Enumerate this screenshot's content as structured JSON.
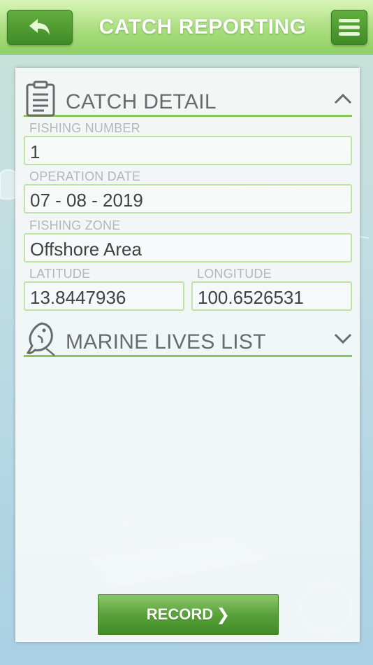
{
  "header": {
    "title": "CATCH REPORTING",
    "back_icon": "back-arrow-icon",
    "menu_icon": "hamburger-menu-icon"
  },
  "catch_detail": {
    "title": "CATCH DETAIL",
    "icon": "clipboard-icon",
    "expanded": true,
    "fishing_number": {
      "label": "FISHING NUMBER",
      "value": "1"
    },
    "operation_date": {
      "label": "OPERATION DATE",
      "value": "07 - 08 - 2019"
    },
    "fishing_zone": {
      "label": "FISHING ZONE",
      "value": "Offshore Area"
    },
    "latitude": {
      "label": "LATITUDE",
      "value": "13.8447936"
    },
    "longitude": {
      "label": "LONGITUDE",
      "value": "100.6526531"
    }
  },
  "marine_lives": {
    "title": "MARINE LIVES LIST",
    "icon": "fish-icon",
    "expanded": false
  },
  "record_button": {
    "label": "RECORD",
    "arrow": "❯"
  },
  "colors": {
    "accent_green": "#86c65a",
    "button_green": "#4a962f",
    "header_green": "#a9dd7e"
  }
}
